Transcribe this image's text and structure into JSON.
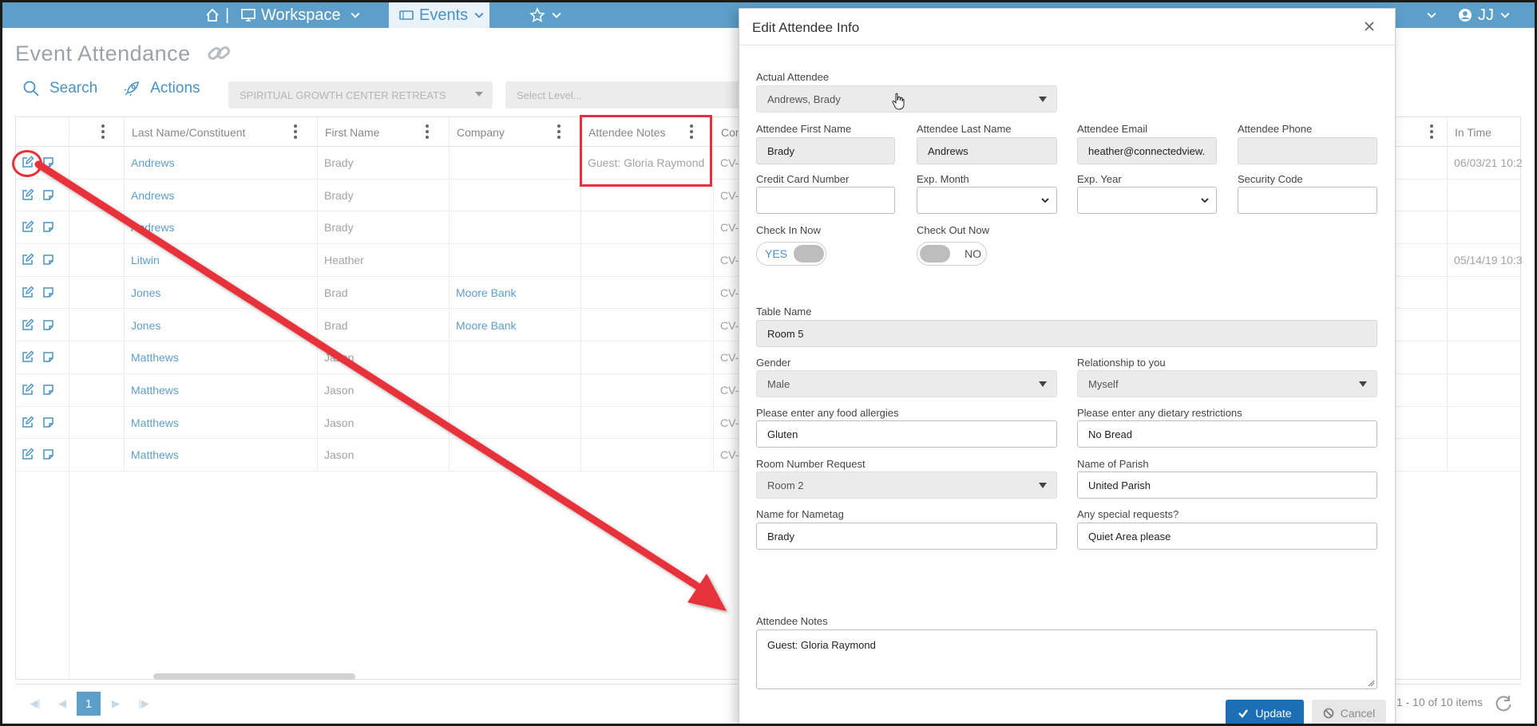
{
  "nav": {
    "separator": "|",
    "workspace_label": "Workspace",
    "events_label": "Events",
    "user_initials": "JJ"
  },
  "page": {
    "title": "Event Attendance",
    "search_label": "Search",
    "actions_label": "Actions",
    "event_select_value": "SPIRITUAL GROWTH CENTER RETREATS",
    "level_select_placeholder": "Select Level..."
  },
  "grid": {
    "columns": {
      "last_name": "Last Name/Constituent",
      "first_name": "First Name",
      "company": "Company",
      "attendee_notes": "Attendee Notes",
      "con_partial": "Con",
      "in_time": "In Time"
    },
    "rows": [
      {
        "last": "Andrews",
        "first": "Brady",
        "company": "",
        "notes": "Guest: Gloria Raymond",
        "cv": "CV-",
        "in_time": "06/03/21 10:2"
      },
      {
        "last": "Andrews",
        "first": "Brady",
        "company": "",
        "notes": "",
        "cv": "CV-",
        "in_time": ""
      },
      {
        "last": "Andrews",
        "first": "Brady",
        "company": "",
        "notes": "",
        "cv": "CV-",
        "in_time": ""
      },
      {
        "last": "Litwin",
        "first": "Heather",
        "company": "",
        "notes": "",
        "cv": "CV-",
        "in_time": "05/14/19 10:3"
      },
      {
        "last": "Jones",
        "first": "Brad",
        "company": "Moore Bank",
        "notes": "",
        "cv": "CV-",
        "in_time": ""
      },
      {
        "last": "Jones",
        "first": "Brad",
        "company": "Moore Bank",
        "notes": "",
        "cv": "CV-",
        "in_time": ""
      },
      {
        "last": "Matthews",
        "first": "Jason",
        "company": "",
        "notes": "",
        "cv": "CV-",
        "in_time": ""
      },
      {
        "last": "Matthews",
        "first": "Jason",
        "company": "",
        "notes": "",
        "cv": "CV-",
        "in_time": ""
      },
      {
        "last": "Matthews",
        "first": "Jason",
        "company": "",
        "notes": "",
        "cv": "CV-",
        "in_time": ""
      },
      {
        "last": "Matthews",
        "first": "Jason",
        "company": "",
        "notes": "",
        "cv": "CV-",
        "in_time": ""
      }
    ]
  },
  "pager": {
    "current_page": "1",
    "info": "1 - 10 of 10 items"
  },
  "modal": {
    "title": "Edit Attendee Info",
    "actual_attendee": {
      "label": "Actual Attendee",
      "value": "Andrews, Brady"
    },
    "first_name": {
      "label": "Attendee First Name",
      "value": "Brady"
    },
    "last_name": {
      "label": "Attendee Last Name",
      "value": "Andrews"
    },
    "email": {
      "label": "Attendee Email",
      "value": "heather@connectedview."
    },
    "phone": {
      "label": "Attendee Phone",
      "value": ""
    },
    "cc_number": {
      "label": "Credit Card Number",
      "value": ""
    },
    "exp_month": {
      "label": "Exp. Month",
      "value": ""
    },
    "exp_year": {
      "label": "Exp. Year",
      "value": ""
    },
    "security_code": {
      "label": "Security Code",
      "value": ""
    },
    "check_in": {
      "label": "Check In Now",
      "state": "YES",
      "on": true
    },
    "check_out": {
      "label": "Check Out Now",
      "state": "NO",
      "on": false
    },
    "table_name": {
      "label": "Table Name",
      "value": "Room 5"
    },
    "gender": {
      "label": "Gender",
      "value": "Male"
    },
    "relationship": {
      "label": "Relationship to you",
      "value": "Myself"
    },
    "food_allergies": {
      "label": "Please enter any food allergies",
      "value": "Gluten"
    },
    "dietary": {
      "label": "Please enter any dietary restrictions",
      "value": "No Bread"
    },
    "room_request": {
      "label": "Room Number Request",
      "value": "Room 2"
    },
    "parish": {
      "label": "Name of Parish",
      "value": "United Parish"
    },
    "nametag": {
      "label": "Name for Nametag",
      "value": "Brady"
    },
    "special_requests": {
      "label": "Any special requests?",
      "value": "Quiet Area please"
    },
    "attendee_notes": {
      "label": "Attendee Notes",
      "value": "Guest: Gloria Raymond"
    },
    "update_label": "Update",
    "cancel_label": "Cancel"
  },
  "colors": {
    "nav_bg": "#5d9fc9",
    "link": "#5d9fc9",
    "annotation_red": "#e8303b",
    "update_button": "#1c6fb5"
  }
}
